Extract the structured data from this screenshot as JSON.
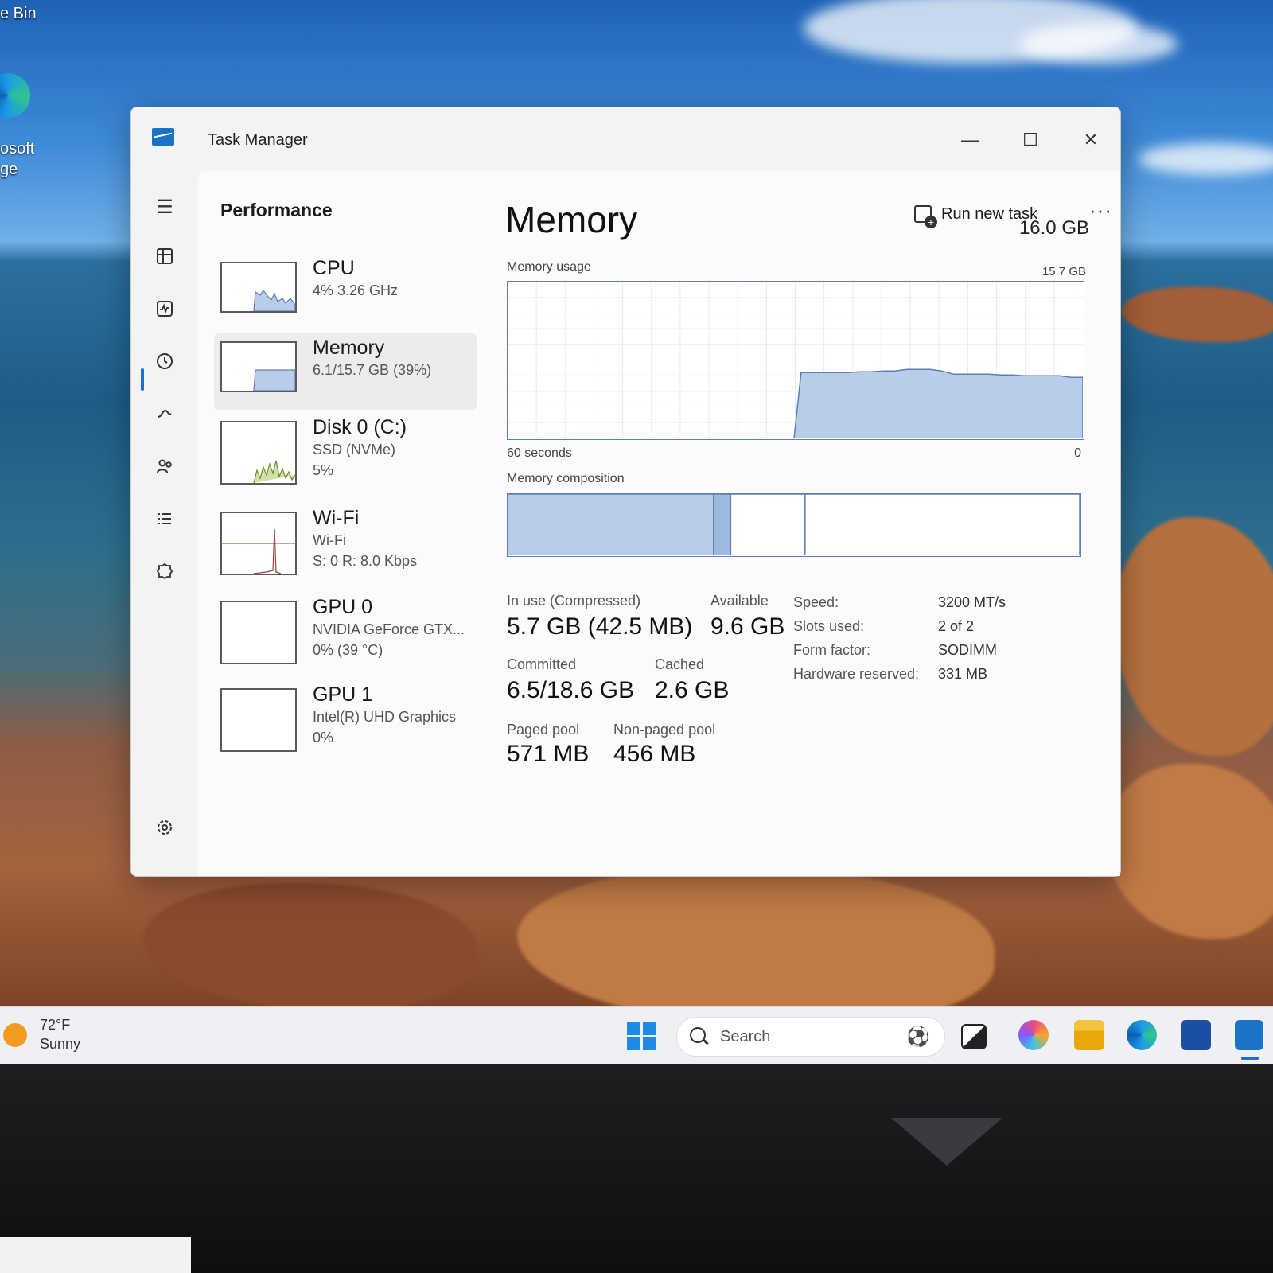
{
  "desktop": {
    "recycle_bin_label": "e Bin",
    "edge_label_line1": "osoft",
    "edge_label_line2": "ge"
  },
  "window": {
    "title": "Task Manager",
    "controls": {
      "minimize": "—",
      "maximize": "☐",
      "close": "✕"
    }
  },
  "nav_icons": [
    "menu-icon",
    "processes-icon",
    "performance-icon",
    "app-history-icon",
    "startup-apps-icon",
    "users-icon",
    "details-icon",
    "services-icon",
    "settings-icon"
  ],
  "header": {
    "title": "Performance",
    "run_new_task": "Run new task",
    "more": "···"
  },
  "devices": [
    {
      "name": "CPU",
      "line1": "4% 3.26 GHz",
      "line2": ""
    },
    {
      "name": "Memory",
      "line1": "6.1/15.7 GB (39%)",
      "line2": ""
    },
    {
      "name": "Disk 0 (C:)",
      "line1": "SSD (NVMe)",
      "line2": "5%"
    },
    {
      "name": "Wi-Fi",
      "line1": "Wi-Fi",
      "line2": "S: 0 R: 8.0 Kbps"
    },
    {
      "name": "GPU 0",
      "line1": "NVIDIA GeForce GTX...",
      "line2": "0% (39 °C)"
    },
    {
      "name": "GPU 1",
      "line1": "Intel(R) UHD Graphics",
      "line2": "0%"
    }
  ],
  "memory": {
    "title": "Memory",
    "total": "16.0 GB",
    "usage_label": "Memory usage",
    "usage_max": "15.7 GB",
    "time_left": "60 seconds",
    "time_right": "0",
    "composition_label": "Memory composition",
    "usage_history_fraction": [
      0,
      0,
      0,
      0,
      0,
      0,
      0,
      0,
      0,
      0,
      0,
      0,
      0,
      0,
      0,
      0,
      0,
      0,
      0,
      0,
      0,
      0,
      0,
      0,
      0,
      0.42,
      0.42,
      0.42,
      0.42,
      0.42,
      0.425,
      0.425,
      0.43,
      0.43,
      0.44,
      0.44,
      0.44,
      0.43,
      0.41,
      0.41,
      0.41,
      0.41,
      0.405,
      0.405,
      0.4,
      0.4,
      0.4,
      0.4,
      0.39,
      0.39
    ],
    "composition": {
      "in_use": 0.36,
      "modified": 0.03,
      "standby": 0.13,
      "free": 0.48
    },
    "stats": {
      "in_use_label": "In use (Compressed)",
      "in_use_value": "5.7 GB (42.5 MB)",
      "available_label": "Available",
      "available_value": "9.6 GB",
      "committed_label": "Committed",
      "committed_value": "6.5/18.6 GB",
      "cached_label": "Cached",
      "cached_value": "2.6 GB",
      "paged_pool_label": "Paged pool",
      "paged_pool_value": "571 MB",
      "nonpaged_pool_label": "Non-paged pool",
      "nonpaged_pool_value": "456 MB"
    },
    "specs": [
      {
        "key": "Speed:",
        "value": "3200 MT/s"
      },
      {
        "key": "Slots used:",
        "value": "2 of 2"
      },
      {
        "key": "Form factor:",
        "value": "SODIMM"
      },
      {
        "key": "Hardware reserved:",
        "value": "331 MB"
      }
    ]
  },
  "taskbar": {
    "temperature": "72°F",
    "condition": "Sunny",
    "search_placeholder": "Search",
    "apps": [
      "task-view-icon",
      "copilot-icon",
      "file-explorer-icon",
      "edge-icon",
      "store-icon",
      "task-manager-icon"
    ]
  },
  "colors": {
    "accent": "#1a6fd0",
    "graph_fill": "#b9cdea",
    "graph_line": "#5d7fb7",
    "wifi_line": "#a23b3b",
    "disk_line": "#6b8f2a"
  }
}
